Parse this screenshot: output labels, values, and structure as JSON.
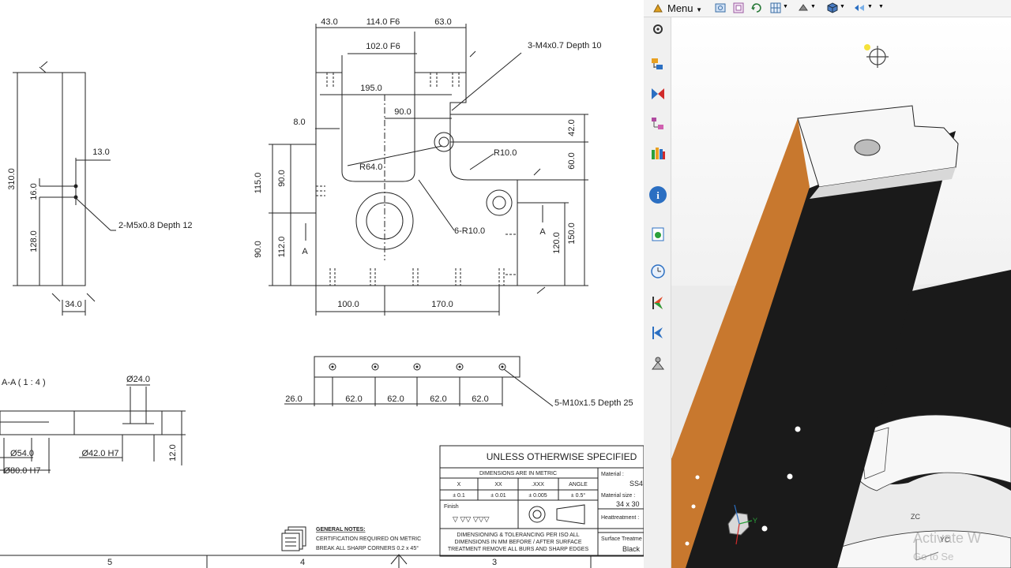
{
  "drawing": {
    "dims_side": [
      "310.0",
      "13.0",
      "16.0",
      "128.0",
      "34.0"
    ],
    "side_note": "2-M5x0.8 Depth 12",
    "dims_front": [
      "43.0",
      "114.0 F6",
      "63.0",
      "102.0 F6",
      "195.0",
      "90.0",
      "8.0",
      "42.0",
      "60.0",
      "R10.0",
      "R64.0",
      "115.0",
      "90.0",
      "90.0",
      "112.0",
      "A",
      "A",
      "120.0",
      "150.0",
      "100.0",
      "170.0"
    ],
    "note_top_holes": "3-M4x0.7 Depth 10",
    "note_fillets": "6-R10.0",
    "dims_bottom": [
      "26.0",
      "62.0",
      "62.0",
      "62.0",
      "62.0"
    ],
    "note_bottom_holes": "5-M10x1.5 Depth 25",
    "section_label": "A-A ( 1 : 4 )",
    "dims_section": [
      "Ø24.0",
      "Ø54.0",
      "Ø80.0 H7",
      "Ø42.0 H7",
      "12.0"
    ],
    "general_notes": {
      "title": "GENERAL NOTES:",
      "line1": "CERTIFICATION REQUIRED ON METRIC",
      "line2": "BREAK ALL SHARP CORNERS 0.2 x 45°"
    },
    "title_block": {
      "header": "UNLESS OTHERWISE SPECIFIED",
      "units_row": "DIMENSIONS ARE IN METRIC",
      "columns": [
        "X",
        "XX",
        ".XXX",
        "ANGLE"
      ],
      "tolerances": [
        "± 0.1",
        "± 0.01",
        "± 0.005",
        "± 0.5°"
      ],
      "finish_label": "Finish",
      "finish_symbols": "▽  ▽▽  ▽▽▽",
      "notes": [
        "DIMENSIONING & TOLERANCING PER ISO ALL",
        "DIMENSIONS IN MM BEFORE / AFTER SURFACE",
        "TREATMENT REMOVE ALL BURS AND SHARP EDGES"
      ],
      "material_label": "Material :",
      "material_value": "SS4",
      "material_size_label": "Material size :",
      "material_size_value": "34 x 30",
      "heattreatment_label": "Heattreatment :",
      "surface_label": "Surface Treatme",
      "surface_value": "Black"
    },
    "zones": [
      "5",
      "4",
      "3"
    ]
  },
  "cad": {
    "menu_label": "Menu",
    "toolbar_icons": [
      "fit-view-icon",
      "snap-icon",
      "rotate-icon",
      "grid-icon",
      "render-style-icon",
      "cube-view-icon",
      "hide-show-icon",
      "more-icon"
    ],
    "sidebar_icons": [
      "settings-icon",
      "assembly-navigator-icon",
      "constraint-navigator-icon",
      "part-navigator-icon",
      "reuse-library-icon",
      "info-icon",
      "web-browser-icon",
      "history-icon",
      "process-studio-icon",
      "roles-icon",
      "system-materials-icon"
    ],
    "axis_labels": {
      "x": "X",
      "y": "Y",
      "zc": "ZC",
      "yc": "YC"
    },
    "colors": {
      "orange_face": "#c8782e",
      "black_face": "#1a1a1a",
      "white_face": "#f7f7f7"
    },
    "watermark": [
      "Activate W",
      "Go to Se"
    ]
  }
}
